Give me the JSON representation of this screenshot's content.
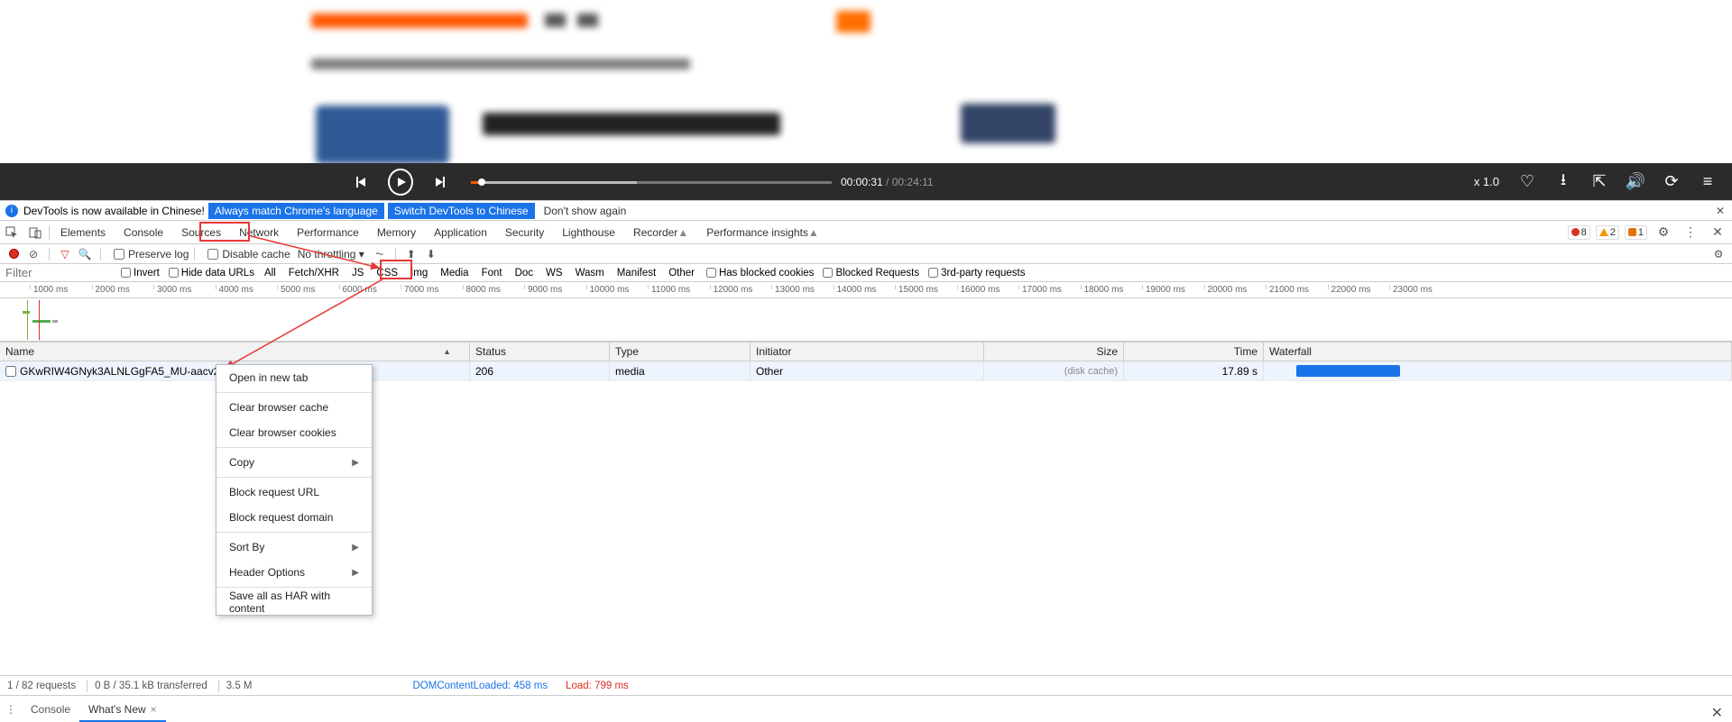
{
  "player": {
    "time_current": "00:00:31",
    "time_separator": " / ",
    "time_total": "00:24:11",
    "speed": "x 1.0"
  },
  "infobar": {
    "text": "DevTools is now available in Chinese!",
    "btn_match": "Always match Chrome's language",
    "btn_switch": "Switch DevTools to Chinese",
    "dont_show": "Don't show again"
  },
  "tabs": {
    "elements": "Elements",
    "console": "Console",
    "sources": "Sources",
    "network": "Network",
    "performance": "Performance",
    "memory": "Memory",
    "application": "Application",
    "security": "Security",
    "lighthouse": "Lighthouse",
    "recorder": "Recorder",
    "perf_insights": "Performance insights"
  },
  "issue_counts": {
    "errors": "8",
    "warnings": "2",
    "issues": "1"
  },
  "net_toolbar": {
    "preserve": "Preserve log",
    "disable_cache": "Disable cache",
    "throttling": "No throttling"
  },
  "filter_row": {
    "placeholder": "Filter",
    "invert": "Invert",
    "hide_data": "Hide data URLs",
    "all": "All",
    "fetchxhr": "Fetch/XHR",
    "js": "JS",
    "css": "CSS",
    "img": "Img",
    "media": "Media",
    "font": "Font",
    "doc": "Doc",
    "ws": "WS",
    "wasm": "Wasm",
    "manifest": "Manifest",
    "other": "Other",
    "blocked_cookies": "Has blocked cookies",
    "blocked_req": "Blocked Requests",
    "third_party": "3rd-party requests"
  },
  "timeline_ticks": [
    "1000 ms",
    "2000 ms",
    "3000 ms",
    "4000 ms",
    "5000 ms",
    "6000 ms",
    "7000 ms",
    "8000 ms",
    "9000 ms",
    "10000 ms",
    "11000 ms",
    "12000 ms",
    "13000 ms",
    "14000 ms",
    "15000 ms",
    "16000 ms",
    "17000 ms",
    "18000 ms",
    "19000 ms",
    "20000 ms",
    "21000 ms",
    "22000 ms",
    "23000 ms"
  ],
  "table": {
    "headers": {
      "name": "Name",
      "status": "Status",
      "type": "Type",
      "initiator": "Initiator",
      "size": "Size",
      "time": "Time",
      "waterfall": "Waterfall"
    },
    "row": {
      "name": "GKwRIW4GNyk3ALNLGgFA5_MU-aacv2-48K.m4a",
      "status": "206",
      "type": "media",
      "initiator": "Other",
      "size": "(disk cache)",
      "time": "17.89 s"
    }
  },
  "context_menu": {
    "open_new_tab": "Open in new tab",
    "clear_cache": "Clear browser cache",
    "clear_cookies": "Clear browser cookies",
    "copy": "Copy",
    "block_url": "Block request URL",
    "block_domain": "Block request domain",
    "sort_by": "Sort By",
    "header_options": "Header Options",
    "save_har": "Save all as HAR with content"
  },
  "statusbar": {
    "requests": "1 / 82 requests",
    "transferred": "0 B / 35.1 kB transferred",
    "resources_prefix": "3.5 M",
    "dom": "DOMContentLoaded: 458 ms",
    "load": "Load: 799 ms"
  },
  "drawer": {
    "console": "Console",
    "whats_new": "What's New"
  }
}
